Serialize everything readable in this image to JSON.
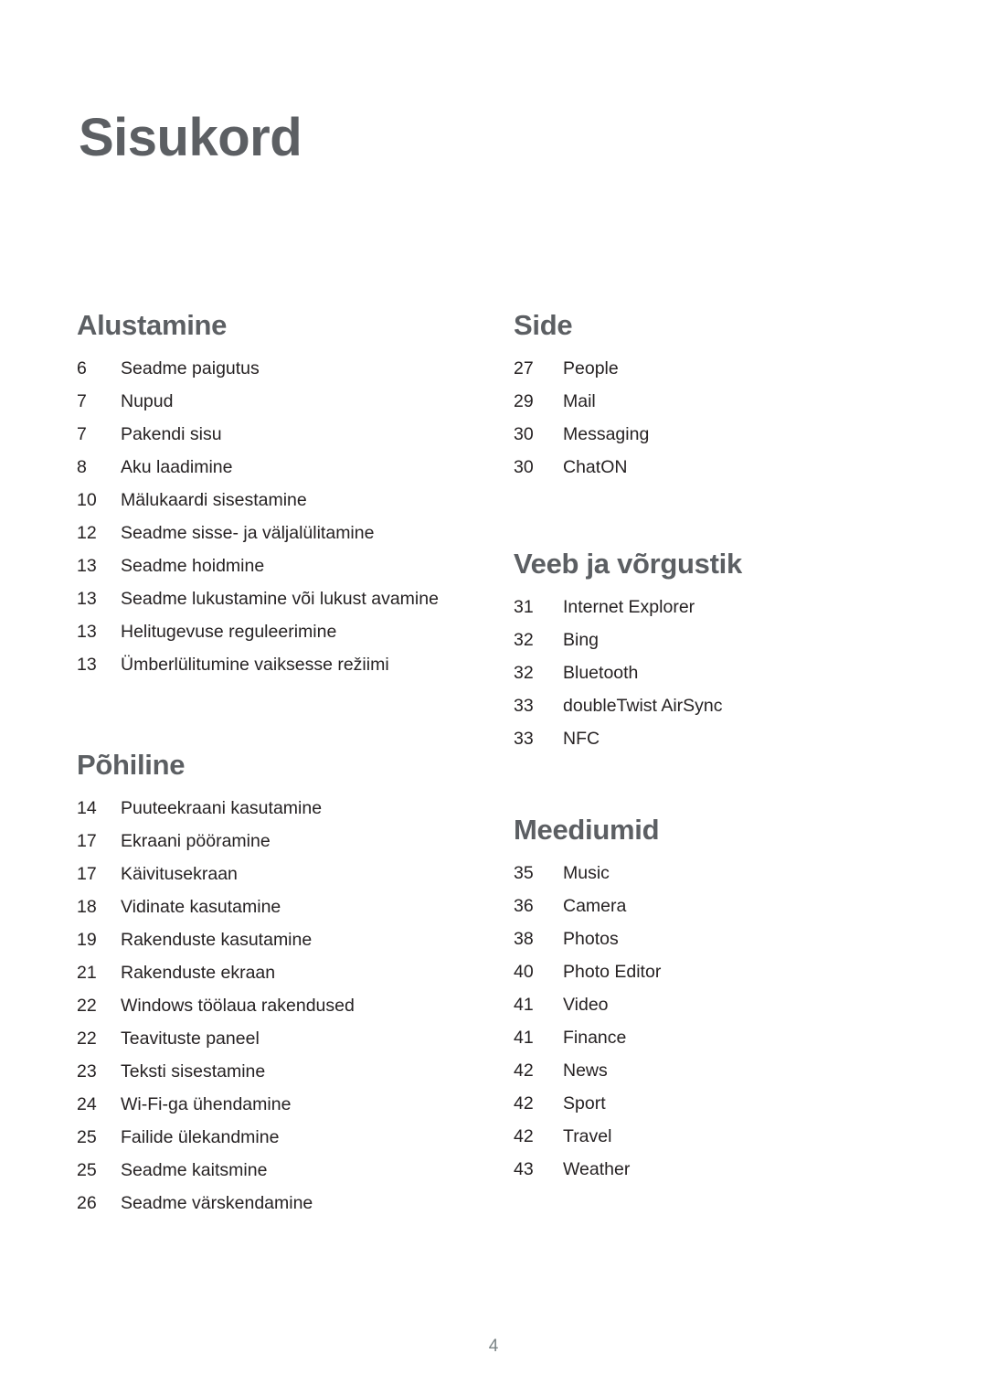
{
  "document": {
    "title": "Sisukord",
    "page_number": "4",
    "heading_color": "#5c5f63",
    "body_color": "#262223",
    "folio_color": "#7b8486",
    "background_color": "#ffffff"
  },
  "columns": {
    "left": {
      "sections": [
        {
          "heading": "Alustamine",
          "entries": [
            {
              "page": "6",
              "label": "Seadme paigutus"
            },
            {
              "page": "7",
              "label": "Nupud"
            },
            {
              "page": "7",
              "label": "Pakendi sisu"
            },
            {
              "page": "8",
              "label": "Aku laadimine"
            },
            {
              "page": "10",
              "label": "Mälukaardi sisestamine"
            },
            {
              "page": "12",
              "label": "Seadme sisse- ja väljalülitamine"
            },
            {
              "page": "13",
              "label": "Seadme hoidmine"
            },
            {
              "page": "13",
              "label": "Seadme lukustamine või lukust avamine"
            },
            {
              "page": "13",
              "label": "Helitugevuse reguleerimine"
            },
            {
              "page": "13",
              "label": "Ümberlülitumine vaiksesse režiimi"
            }
          ]
        },
        {
          "heading": "Põhiline",
          "entries": [
            {
              "page": "14",
              "label": "Puuteekraani kasutamine"
            },
            {
              "page": "17",
              "label": "Ekraani pööramine"
            },
            {
              "page": "17",
              "label": "Käivitusekraan"
            },
            {
              "page": "18",
              "label": "Vidinate kasutamine"
            },
            {
              "page": "19",
              "label": "Rakenduste kasutamine"
            },
            {
              "page": "21",
              "label": "Rakenduste ekraan"
            },
            {
              "page": "22",
              "label": "Windows töölaua rakendused"
            },
            {
              "page": "22",
              "label": "Teavituste paneel"
            },
            {
              "page": "23",
              "label": "Teksti sisestamine"
            },
            {
              "page": "24",
              "label": "Wi-Fi-ga ühendamine"
            },
            {
              "page": "25",
              "label": "Failide ülekandmine"
            },
            {
              "page": "25",
              "label": "Seadme kaitsmine"
            },
            {
              "page": "26",
              "label": "Seadme värskendamine"
            }
          ]
        }
      ]
    },
    "right": {
      "sections": [
        {
          "heading": "Side",
          "entries": [
            {
              "page": "27",
              "label": "People"
            },
            {
              "page": "29",
              "label": "Mail"
            },
            {
              "page": "30",
              "label": "Messaging"
            },
            {
              "page": "30",
              "label": "ChatON"
            }
          ]
        },
        {
          "heading": "Veeb ja võrgustik",
          "entries": [
            {
              "page": "31",
              "label": "Internet Explorer"
            },
            {
              "page": "32",
              "label": "Bing"
            },
            {
              "page": "32",
              "label": "Bluetooth"
            },
            {
              "page": "33",
              "label": "doubleTwist AirSync"
            },
            {
              "page": "33",
              "label": "NFC"
            }
          ]
        },
        {
          "heading": "Meediumid",
          "entries": [
            {
              "page": "35",
              "label": "Music"
            },
            {
              "page": "36",
              "label": "Camera"
            },
            {
              "page": "38",
              "label": "Photos"
            },
            {
              "page": "40",
              "label": "Photo Editor"
            },
            {
              "page": "41",
              "label": "Video"
            },
            {
              "page": "41",
              "label": "Finance"
            },
            {
              "page": "42",
              "label": "News"
            },
            {
              "page": "42",
              "label": "Sport"
            },
            {
              "page": "42",
              "label": "Travel"
            },
            {
              "page": "43",
              "label": "Weather"
            }
          ]
        }
      ]
    }
  }
}
